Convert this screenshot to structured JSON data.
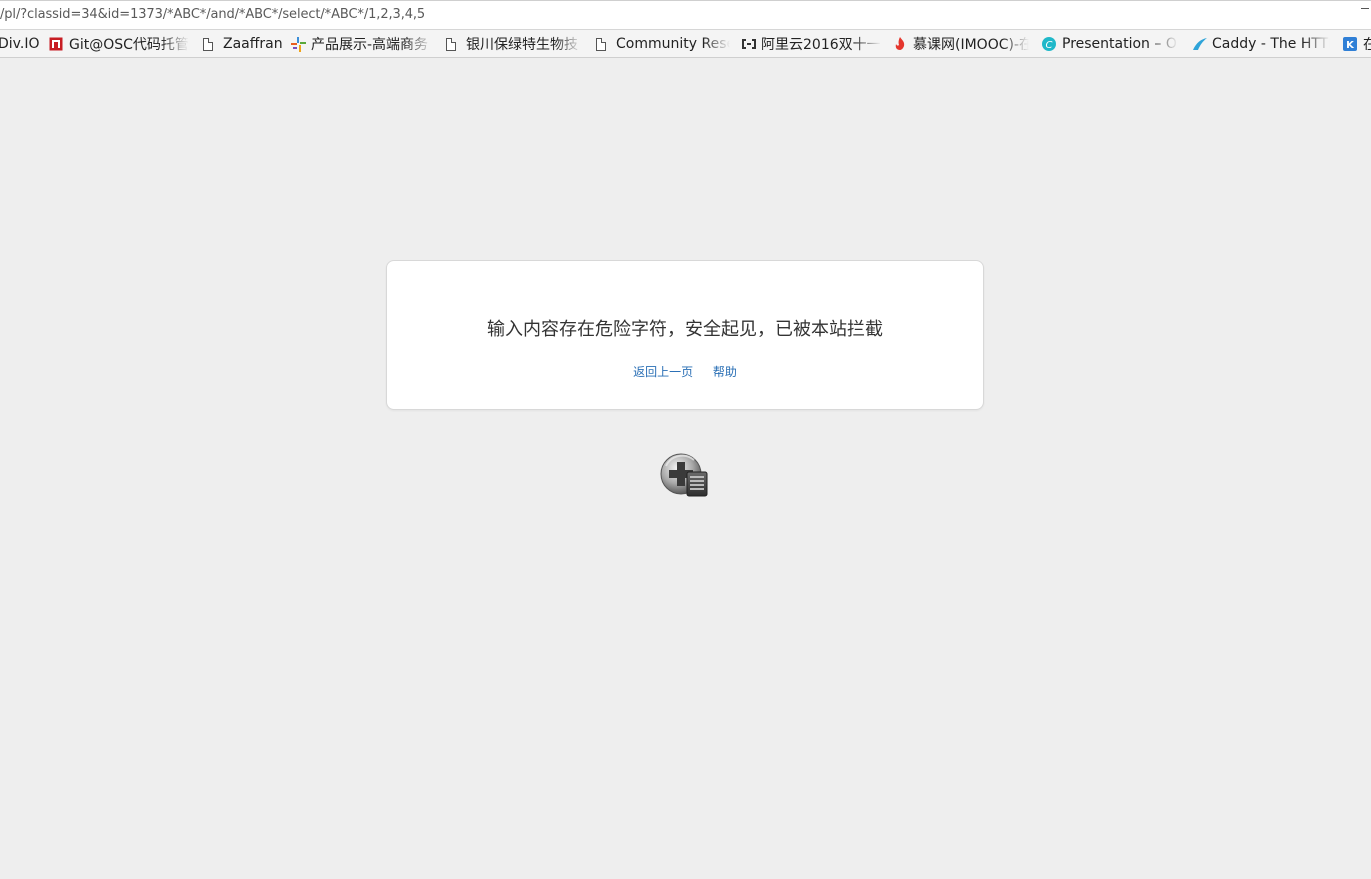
{
  "url": {
    "text": "/pl/?classid=34&id=1373/*ABC*/and/*ABC*/select/*ABC*/1,2,3,4,5"
  },
  "bookmarks": [
    {
      "label": "Div.IO",
      "icon": "none"
    },
    {
      "label": "Git@OSC代码托管",
      "icon": "gitosc-icon"
    },
    {
      "label": "Zaaffran",
      "icon": "page-icon"
    },
    {
      "label": "产品展示-高端商务",
      "icon": "product-icon"
    },
    {
      "label": "银川保绿特生物技",
      "icon": "page-icon"
    },
    {
      "label": "Community Rese",
      "icon": "page-icon"
    },
    {
      "label": "阿里云2016双十一",
      "icon": "aliyun-icon"
    },
    {
      "label": "慕课网(IMOOC)-在",
      "icon": "imooc-icon"
    },
    {
      "label": "Presentation – O",
      "icon": "presentation-icon"
    },
    {
      "label": "Caddy - The HTTP",
      "icon": "caddy-icon"
    },
    {
      "label": "在",
      "icon": "k-icon"
    }
  ],
  "block_page": {
    "message": "输入内容存在危险字符，安全起见，已被本站拦截",
    "back_link": "返回上一页",
    "help_link": "帮助"
  },
  "colors": {
    "background": "#eeeeee",
    "link": "#2a6fb5",
    "card": "#ffffff"
  }
}
